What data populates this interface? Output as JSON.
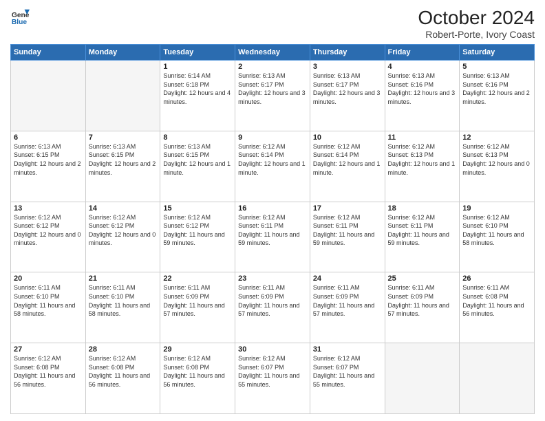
{
  "header": {
    "logo_line1": "General",
    "logo_line2": "Blue",
    "title": "October 2024",
    "subtitle": "Robert-Porte, Ivory Coast"
  },
  "days_of_week": [
    "Sunday",
    "Monday",
    "Tuesday",
    "Wednesday",
    "Thursday",
    "Friday",
    "Saturday"
  ],
  "weeks": [
    [
      {
        "day": "",
        "info": ""
      },
      {
        "day": "",
        "info": ""
      },
      {
        "day": "1",
        "info": "Sunrise: 6:14 AM\nSunset: 6:18 PM\nDaylight: 12 hours and 4 minutes."
      },
      {
        "day": "2",
        "info": "Sunrise: 6:13 AM\nSunset: 6:17 PM\nDaylight: 12 hours and 3 minutes."
      },
      {
        "day": "3",
        "info": "Sunrise: 6:13 AM\nSunset: 6:17 PM\nDaylight: 12 hours and 3 minutes."
      },
      {
        "day": "4",
        "info": "Sunrise: 6:13 AM\nSunset: 6:16 PM\nDaylight: 12 hours and 3 minutes."
      },
      {
        "day": "5",
        "info": "Sunrise: 6:13 AM\nSunset: 6:16 PM\nDaylight: 12 hours and 2 minutes."
      }
    ],
    [
      {
        "day": "6",
        "info": "Sunrise: 6:13 AM\nSunset: 6:15 PM\nDaylight: 12 hours and 2 minutes."
      },
      {
        "day": "7",
        "info": "Sunrise: 6:13 AM\nSunset: 6:15 PM\nDaylight: 12 hours and 2 minutes."
      },
      {
        "day": "8",
        "info": "Sunrise: 6:13 AM\nSunset: 6:15 PM\nDaylight: 12 hours and 1 minute."
      },
      {
        "day": "9",
        "info": "Sunrise: 6:12 AM\nSunset: 6:14 PM\nDaylight: 12 hours and 1 minute."
      },
      {
        "day": "10",
        "info": "Sunrise: 6:12 AM\nSunset: 6:14 PM\nDaylight: 12 hours and 1 minute."
      },
      {
        "day": "11",
        "info": "Sunrise: 6:12 AM\nSunset: 6:13 PM\nDaylight: 12 hours and 1 minute."
      },
      {
        "day": "12",
        "info": "Sunrise: 6:12 AM\nSunset: 6:13 PM\nDaylight: 12 hours and 0 minutes."
      }
    ],
    [
      {
        "day": "13",
        "info": "Sunrise: 6:12 AM\nSunset: 6:12 PM\nDaylight: 12 hours and 0 minutes."
      },
      {
        "day": "14",
        "info": "Sunrise: 6:12 AM\nSunset: 6:12 PM\nDaylight: 12 hours and 0 minutes."
      },
      {
        "day": "15",
        "info": "Sunrise: 6:12 AM\nSunset: 6:12 PM\nDaylight: 11 hours and 59 minutes."
      },
      {
        "day": "16",
        "info": "Sunrise: 6:12 AM\nSunset: 6:11 PM\nDaylight: 11 hours and 59 minutes."
      },
      {
        "day": "17",
        "info": "Sunrise: 6:12 AM\nSunset: 6:11 PM\nDaylight: 11 hours and 59 minutes."
      },
      {
        "day": "18",
        "info": "Sunrise: 6:12 AM\nSunset: 6:11 PM\nDaylight: 11 hours and 59 minutes."
      },
      {
        "day": "19",
        "info": "Sunrise: 6:12 AM\nSunset: 6:10 PM\nDaylight: 11 hours and 58 minutes."
      }
    ],
    [
      {
        "day": "20",
        "info": "Sunrise: 6:11 AM\nSunset: 6:10 PM\nDaylight: 11 hours and 58 minutes."
      },
      {
        "day": "21",
        "info": "Sunrise: 6:11 AM\nSunset: 6:10 PM\nDaylight: 11 hours and 58 minutes."
      },
      {
        "day": "22",
        "info": "Sunrise: 6:11 AM\nSunset: 6:09 PM\nDaylight: 11 hours and 57 minutes."
      },
      {
        "day": "23",
        "info": "Sunrise: 6:11 AM\nSunset: 6:09 PM\nDaylight: 11 hours and 57 minutes."
      },
      {
        "day": "24",
        "info": "Sunrise: 6:11 AM\nSunset: 6:09 PM\nDaylight: 11 hours and 57 minutes."
      },
      {
        "day": "25",
        "info": "Sunrise: 6:11 AM\nSunset: 6:09 PM\nDaylight: 11 hours and 57 minutes."
      },
      {
        "day": "26",
        "info": "Sunrise: 6:11 AM\nSunset: 6:08 PM\nDaylight: 11 hours and 56 minutes."
      }
    ],
    [
      {
        "day": "27",
        "info": "Sunrise: 6:12 AM\nSunset: 6:08 PM\nDaylight: 11 hours and 56 minutes."
      },
      {
        "day": "28",
        "info": "Sunrise: 6:12 AM\nSunset: 6:08 PM\nDaylight: 11 hours and 56 minutes."
      },
      {
        "day": "29",
        "info": "Sunrise: 6:12 AM\nSunset: 6:08 PM\nDaylight: 11 hours and 56 minutes."
      },
      {
        "day": "30",
        "info": "Sunrise: 6:12 AM\nSunset: 6:07 PM\nDaylight: 11 hours and 55 minutes."
      },
      {
        "day": "31",
        "info": "Sunrise: 6:12 AM\nSunset: 6:07 PM\nDaylight: 11 hours and 55 minutes."
      },
      {
        "day": "",
        "info": ""
      },
      {
        "day": "",
        "info": ""
      }
    ]
  ]
}
